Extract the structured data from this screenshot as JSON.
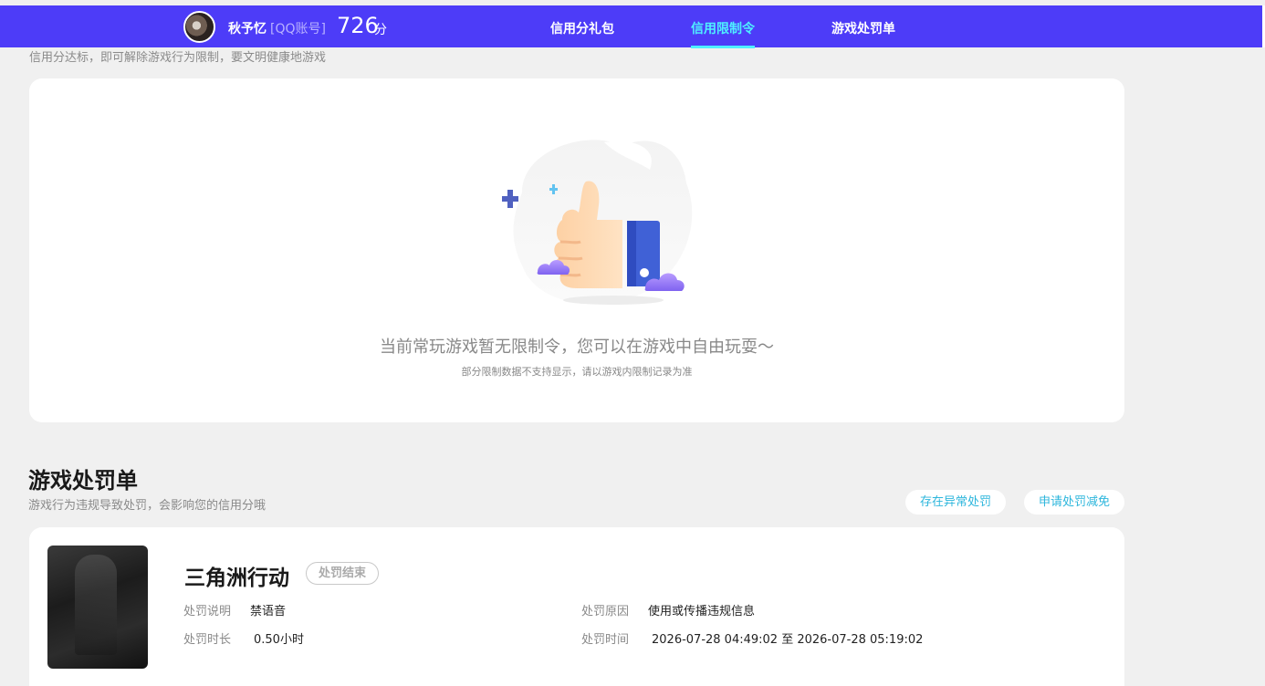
{
  "header": {
    "username": "秋予忆",
    "account_type": "[QQ账号]",
    "score": "726",
    "score_unit": "分",
    "tabs": [
      {
        "label": "信用分礼包",
        "active": false
      },
      {
        "label": "信用限制令",
        "active": true
      },
      {
        "label": "游戏处罚单",
        "active": false
      }
    ]
  },
  "restriction": {
    "subtitle": "信用分达标，即可解除游戏行为限制，要文明健康地游戏",
    "empty_message": "当前常玩游戏暂无限制令，您可以在游戏中自由玩耍～",
    "empty_note": "部分限制数据不支持显示，请以游戏内限制记录为准"
  },
  "penalty_section": {
    "title": "游戏处罚单",
    "description": "游戏行为违规导致处罚，会影响您的信用分哦",
    "buttons": {
      "abnormal": "存在异常处罚",
      "appeal": "申请处罚减免"
    }
  },
  "penalty_record": {
    "game_name": "三角洲行动",
    "status": "处罚结束",
    "desc_label": "处罚说明",
    "desc_value": "禁语音",
    "reason_label": "处罚原因",
    "reason_value": "使用或传播违规信息",
    "duration_label": "处罚时长",
    "duration_value": "0.50小时",
    "time_label": "处罚时间",
    "time_value": "2026-07-28 04:49:02 至 2026-07-28 05:19:02"
  },
  "colors": {
    "brand": "#4d3cf8",
    "active_tab": "#4ef0ff",
    "link": "#2cb6dc",
    "page_bg": "#f0f0f0"
  },
  "icons": {
    "illustration": "thumbs-up-illustration"
  }
}
